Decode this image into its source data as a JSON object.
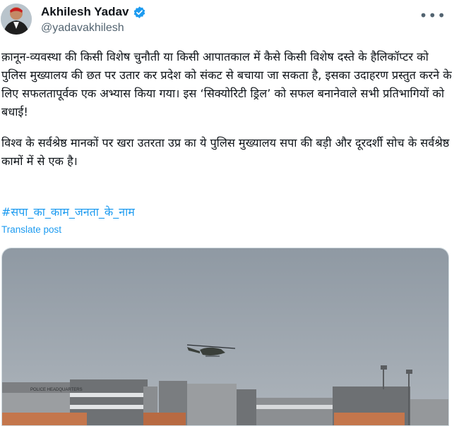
{
  "author": {
    "display_name": "Akhilesh Yadav",
    "handle": "@yadavakhilesh",
    "verified": true,
    "avatar_icon": "profile-photo"
  },
  "more_icon": "ellipsis-icon",
  "tweet": {
    "lines": [
      "क़ानून-व्यवस्था की किसी विशेष चुनौती या किसी आपातकाल में कैसे किसी विशेष दस्ते के",
      "हैलिकॉप्टर को पुलिस मुख्यालय की छत पर उतार कर प्रदेश को संकट से बचाया जा सकता",
      "है, इसका उदाहरण प्रस्तुत करने के लिए सफलतापूर्वक एक अभ्यास किया गया। इस",
      "‘सिक्योरिटी ड्रिल’ को सफल बनानेवाले सभी प्रतिभागियों को बधाई!",
      "विश्व के सर्वश्रेष्ठ मानकों पर खरा उतरता उप्र का ये पुलिस मुख्यालय सपा की बड़ी और",
      "दूरदर्शी सोच के सर्वश्रेष्ठ कामों में से एक है।"
    ],
    "hashtag": "#सपा_का_काम_जनता_के_नाम",
    "translate_label": "Translate post"
  },
  "media": {
    "building_sign": "POLICE HEADQUARTERS"
  },
  "colors": {
    "link": "#1d9bf0",
    "verified": "#1d9bf0",
    "secondary_text": "#536471",
    "sky": "#9aa3ad"
  }
}
